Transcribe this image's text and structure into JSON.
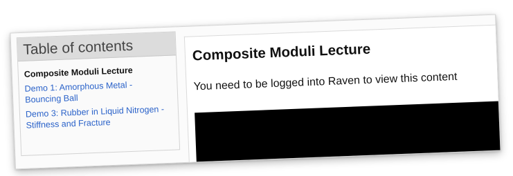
{
  "sidebar": {
    "title": "Table of contents",
    "current_item": "Composite Moduli Lecture",
    "links": [
      "Demo 1: Amorphous Metal - Bouncing Ball",
      "Demo 3: Rubber in Liquid Nitrogen - Stiffness and Fracture"
    ]
  },
  "main": {
    "title": "Composite Moduli Lecture",
    "message": "You need to be logged into Raven to view this content"
  },
  "colors": {
    "link": "#2a62c9",
    "sidebar_header_bg": "#dcdcdc",
    "video_bg": "#000000"
  }
}
